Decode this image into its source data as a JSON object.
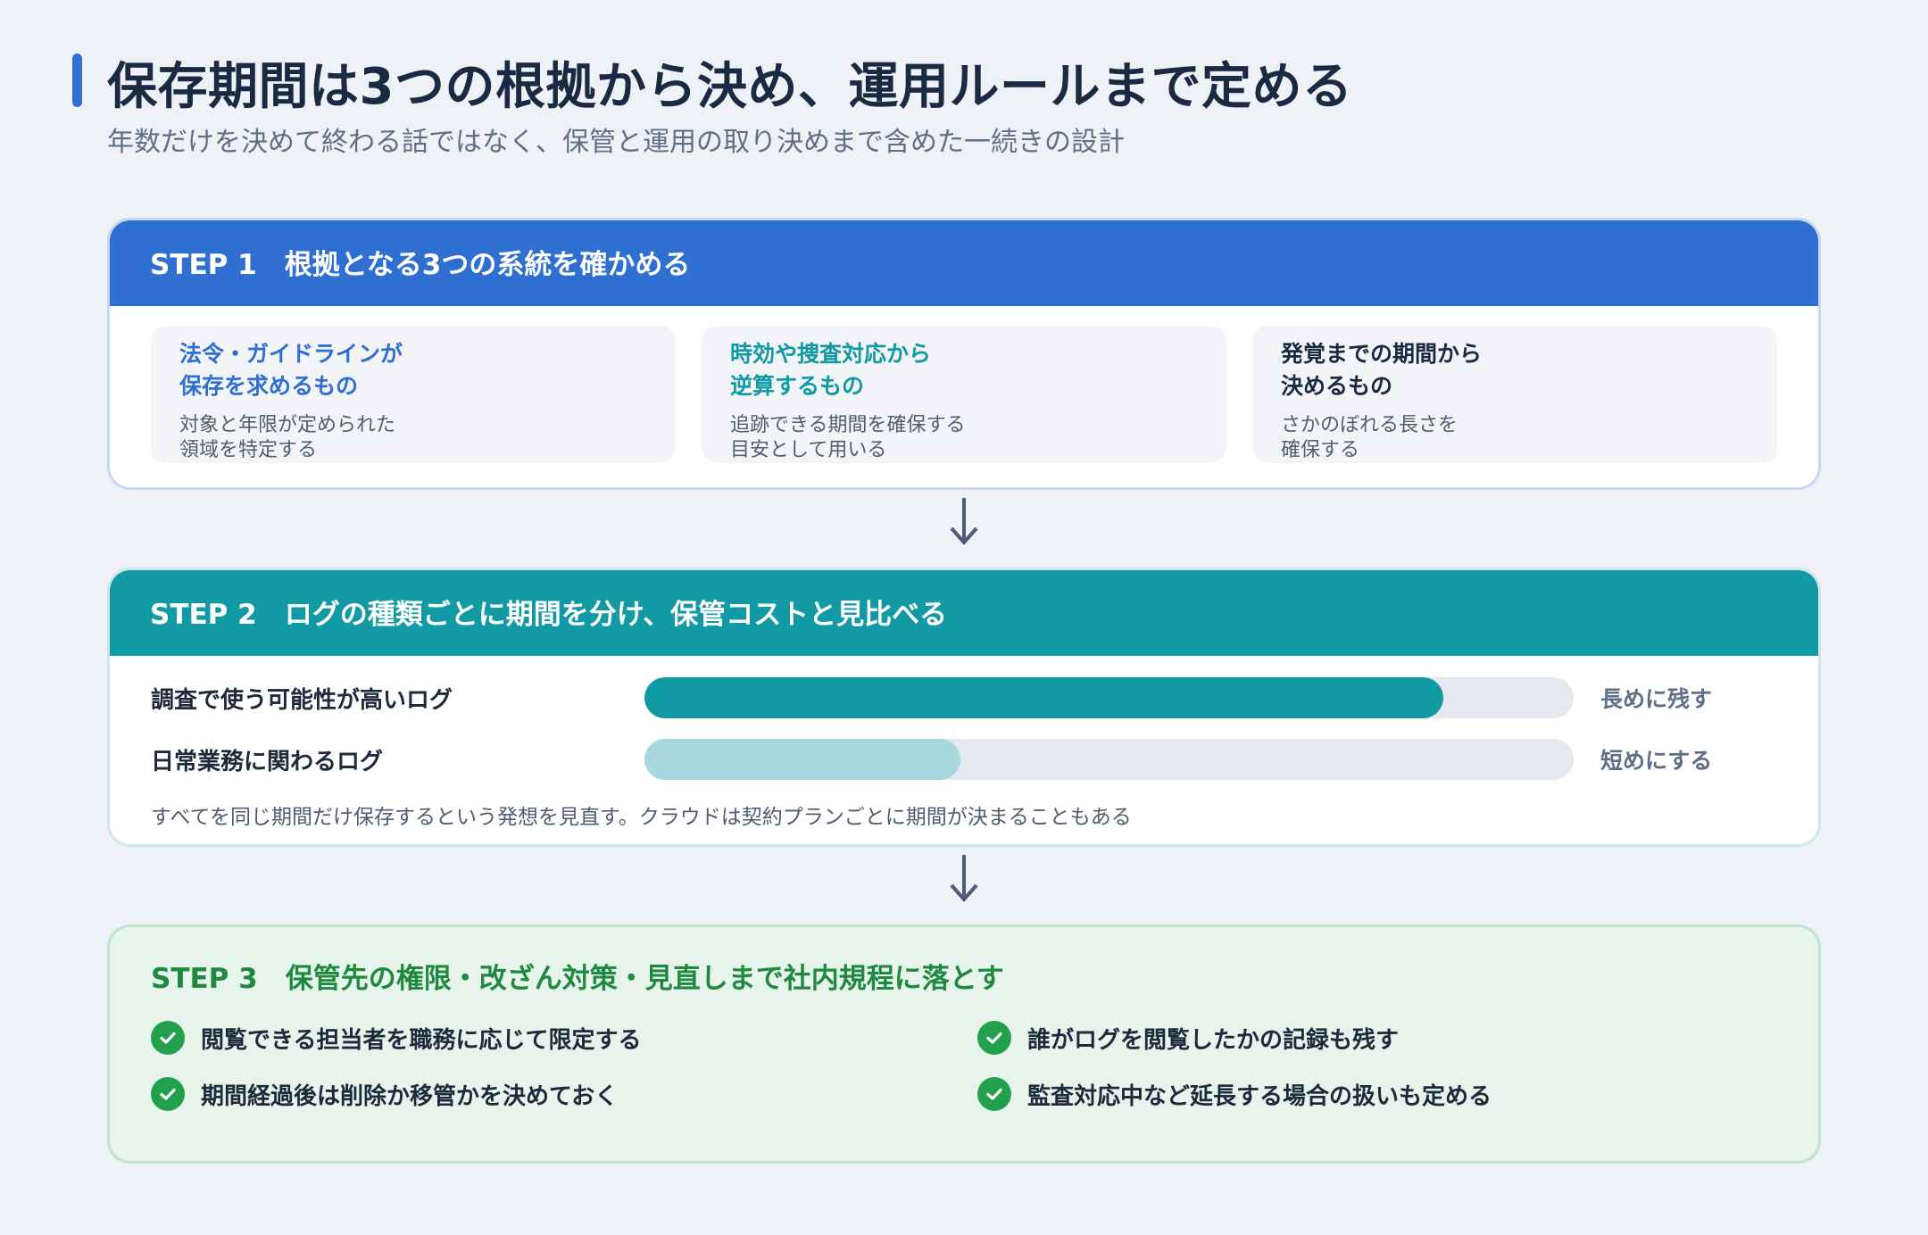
{
  "header": {
    "title": "保存期間は3つの根拠から決め、運用ルールまで定める",
    "subtitle": "年数だけを決めて終わる話ではなく、保管と運用の取り決めまで含めた一続きの設計"
  },
  "step1": {
    "heading": "STEP 1　根拠となる3つの系統を確かめる",
    "color": "#2f6fd1",
    "sources": [
      {
        "title": "法令・ガイドラインが\n保存を求めるもの",
        "desc": "対象と年限が定められた\n領域を特定する",
        "color": "#2f6fd1"
      },
      {
        "title": "時効や捜査対応から\n逆算するもの",
        "desc": "追跡できる期間を確保する\n目安として用いる",
        "color": "#119aa3"
      },
      {
        "title": "発覚までの期間から\n決めるもの",
        "desc": "さかのぼれる長さを\n確保する",
        "color": "#1b2a43"
      }
    ]
  },
  "step2": {
    "heading": "STEP 2　ログの種類ごとに期間を分け、保管コストと見比べる",
    "color": "#119aa3",
    "rows": [
      {
        "label": "調査で使う可能性が高いログ",
        "note": "長めに残す",
        "level": 0.86,
        "color": "#119aa3"
      },
      {
        "label": "日常業務に関わるログ",
        "note": "短めにする",
        "level": 0.34,
        "color": "#a8d8dd"
      }
    ],
    "note": "すべてを同じ期間だけ保存するという発想を見直す。クラウドは契約プランごとに期間が決まることもある"
  },
  "step3": {
    "heading": "STEP 3　保管先の権限・改ざん対策・見直しまで社内規程に落とす",
    "color": "#1f8a3f",
    "items": [
      "閲覧できる担当者を職務に応じて限定する",
      "誰がログを閲覧したかの記録も残す",
      "期間経過後は削除か移管かを決めておく",
      "監査対応中など延長する場合の扱いも定める"
    ]
  }
}
